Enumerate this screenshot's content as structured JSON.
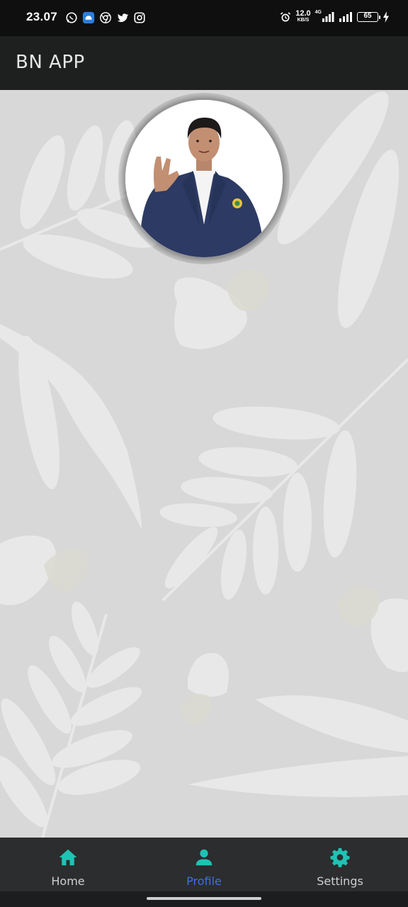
{
  "status_bar": {
    "time": "23.07",
    "app_icons": [
      "whatsapp-icon",
      "chat-app-icon",
      "chrome-icon",
      "twitter-icon",
      "instagram-icon"
    ],
    "net_speed_value": "12.0",
    "net_speed_unit": "KB/S",
    "network_type": "4G",
    "battery_level": "65",
    "battery_charging": true
  },
  "app_bar": {
    "title": "BN APP"
  },
  "profile": {
    "avatar": "profile-photo"
  },
  "bottom_nav": {
    "items": [
      {
        "label": "Home",
        "icon": "home-icon",
        "active": false
      },
      {
        "label": "Profile",
        "icon": "person-icon",
        "active": true
      },
      {
        "label": "Settings",
        "icon": "gear-icon",
        "active": false
      }
    ]
  },
  "colors": {
    "status_bar_bg": "#0f0f0f",
    "app_bar_bg": "#1e1f1f",
    "content_bg": "#d8d8d8",
    "nav_bg": "#2b2d2e",
    "nav_icon": "#1fc3b3",
    "nav_active_label": "#3f6fe4",
    "nav_label": "#cfcfcf"
  }
}
